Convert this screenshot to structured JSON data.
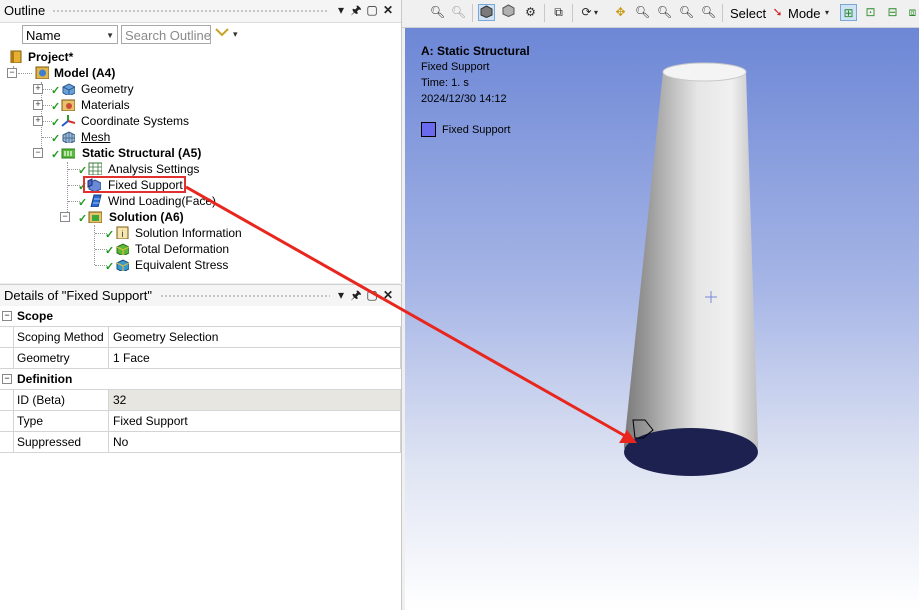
{
  "outline": {
    "title": "Outline",
    "filter_by": "Name",
    "search_placeholder": "Search Outline",
    "tree": [
      {
        "label": "Project*",
        "icon": "project-icon",
        "bold": true
      },
      {
        "label": "Model (A4)",
        "icon": "model-icon",
        "bold": true
      },
      {
        "label": "Geometry",
        "icon": "geometry-icon"
      },
      {
        "label": "Materials",
        "icon": "materials-icon"
      },
      {
        "label": "Coordinate Systems",
        "icon": "coordinate-systems-icon"
      },
      {
        "label": "Mesh",
        "icon": "mesh-icon"
      },
      {
        "label": "Static Structural (A5)",
        "icon": "static-structural-icon",
        "bold": true
      },
      {
        "label": "Analysis Settings",
        "icon": "analysis-settings-icon"
      },
      {
        "label": "Fixed Support",
        "icon": "fixed-support-icon",
        "selected": true
      },
      {
        "label": "Wind Loading(Face)",
        "icon": "pressure-icon"
      },
      {
        "label": "Solution (A6)",
        "icon": "solution-icon",
        "bold": true
      },
      {
        "label": "Solution Information",
        "icon": "solution-information-icon"
      },
      {
        "label": "Total Deformation",
        "icon": "total-deformation-icon"
      },
      {
        "label": "Equivalent Stress",
        "icon": "equivalent-stress-icon"
      }
    ]
  },
  "details": {
    "title": "Details of \"Fixed Support\"",
    "groups": [
      {
        "name": "Scope",
        "rows": [
          {
            "key": "Scoping Method",
            "value": "Geometry Selection"
          },
          {
            "key": "Geometry",
            "value": "1 Face"
          }
        ]
      },
      {
        "name": "Definition",
        "rows": [
          {
            "key": "ID (Beta)",
            "value": "32"
          },
          {
            "key": "Type",
            "value": "Fixed Support"
          },
          {
            "key": "Suppressed",
            "value": "No"
          }
        ]
      }
    ]
  },
  "toolbar": {
    "select_label": "Select",
    "mode_label": "Mode"
  },
  "viewport": {
    "analysis": "A: Static Structural",
    "object": "Fixed Support",
    "time": "Time: 1. s",
    "date": "2024/12/30 14:12",
    "legend_label": "Fixed Support",
    "legend_color": "#6a6aee",
    "base_face_color": "#1d2150",
    "annotation_color": "#e8261e"
  }
}
